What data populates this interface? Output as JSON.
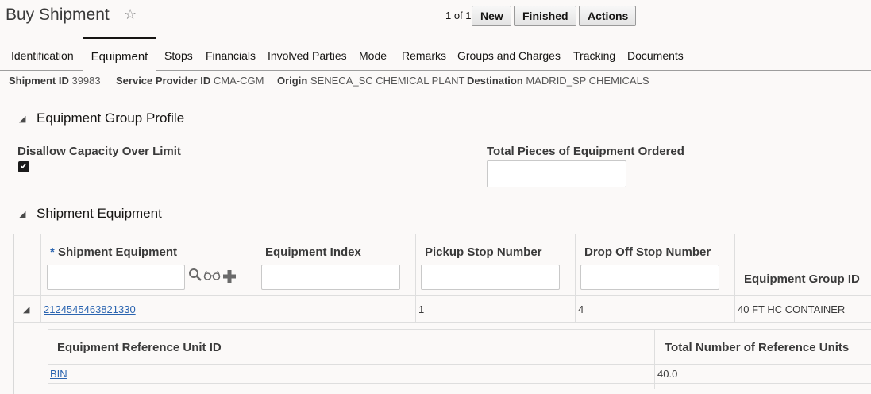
{
  "header": {
    "title": "Buy Shipment",
    "favorite_icon": "star-outline-icon",
    "pager": "1 of 1",
    "buttons": {
      "new": "New",
      "finished": "Finished",
      "actions": "Actions"
    }
  },
  "tabs": [
    {
      "label": "Identification"
    },
    {
      "label": "Equipment",
      "active": true
    },
    {
      "label": "Stops"
    },
    {
      "label": "Financials"
    },
    {
      "label": "Involved Parties"
    },
    {
      "label": "Mode"
    },
    {
      "label": "Remarks"
    },
    {
      "label": "Groups and Charges"
    },
    {
      "label": "Tracking"
    },
    {
      "label": "Documents"
    }
  ],
  "info": {
    "shipment_id_label": "Shipment ID",
    "shipment_id": "39983",
    "service_provider_label": "Service Provider ID",
    "service_provider": "CMA-CGM",
    "origin_label": "Origin",
    "origin": "SENECA_SC CHEMICAL PLANT",
    "destination_label": "Destination",
    "destination": "MADRID_SP CHEMICALS"
  },
  "equipment_group_profile": {
    "title": "Equipment Group Profile",
    "disallow_label": "Disallow Capacity Over Limit",
    "disallow_checked": true,
    "total_pieces_label": "Total Pieces of Equipment Ordered",
    "total_pieces_value": ""
  },
  "shipment_equipment": {
    "title": "Shipment Equipment",
    "required_marker": "*",
    "columns": {
      "shipment_equipment": "Shipment Equipment",
      "equipment_index": "Equipment Index",
      "pickup_stop": "Pickup Stop Number",
      "dropoff_stop": "Drop Off Stop Number",
      "equipment_group_id": "Equipment Group ID"
    },
    "row": {
      "shipment_equipment": "2124545463821330",
      "equipment_index": "",
      "pickup_stop": "1",
      "dropoff_stop": "4",
      "equipment_group_id": "40 FT HC CONTAINER"
    },
    "detail": {
      "columns": {
        "unit_id": "Equipment Reference Unit ID",
        "total_units": "Total Number of Reference Units"
      },
      "row": {
        "unit_id": "BIN",
        "total_units": "40.0"
      }
    }
  }
}
